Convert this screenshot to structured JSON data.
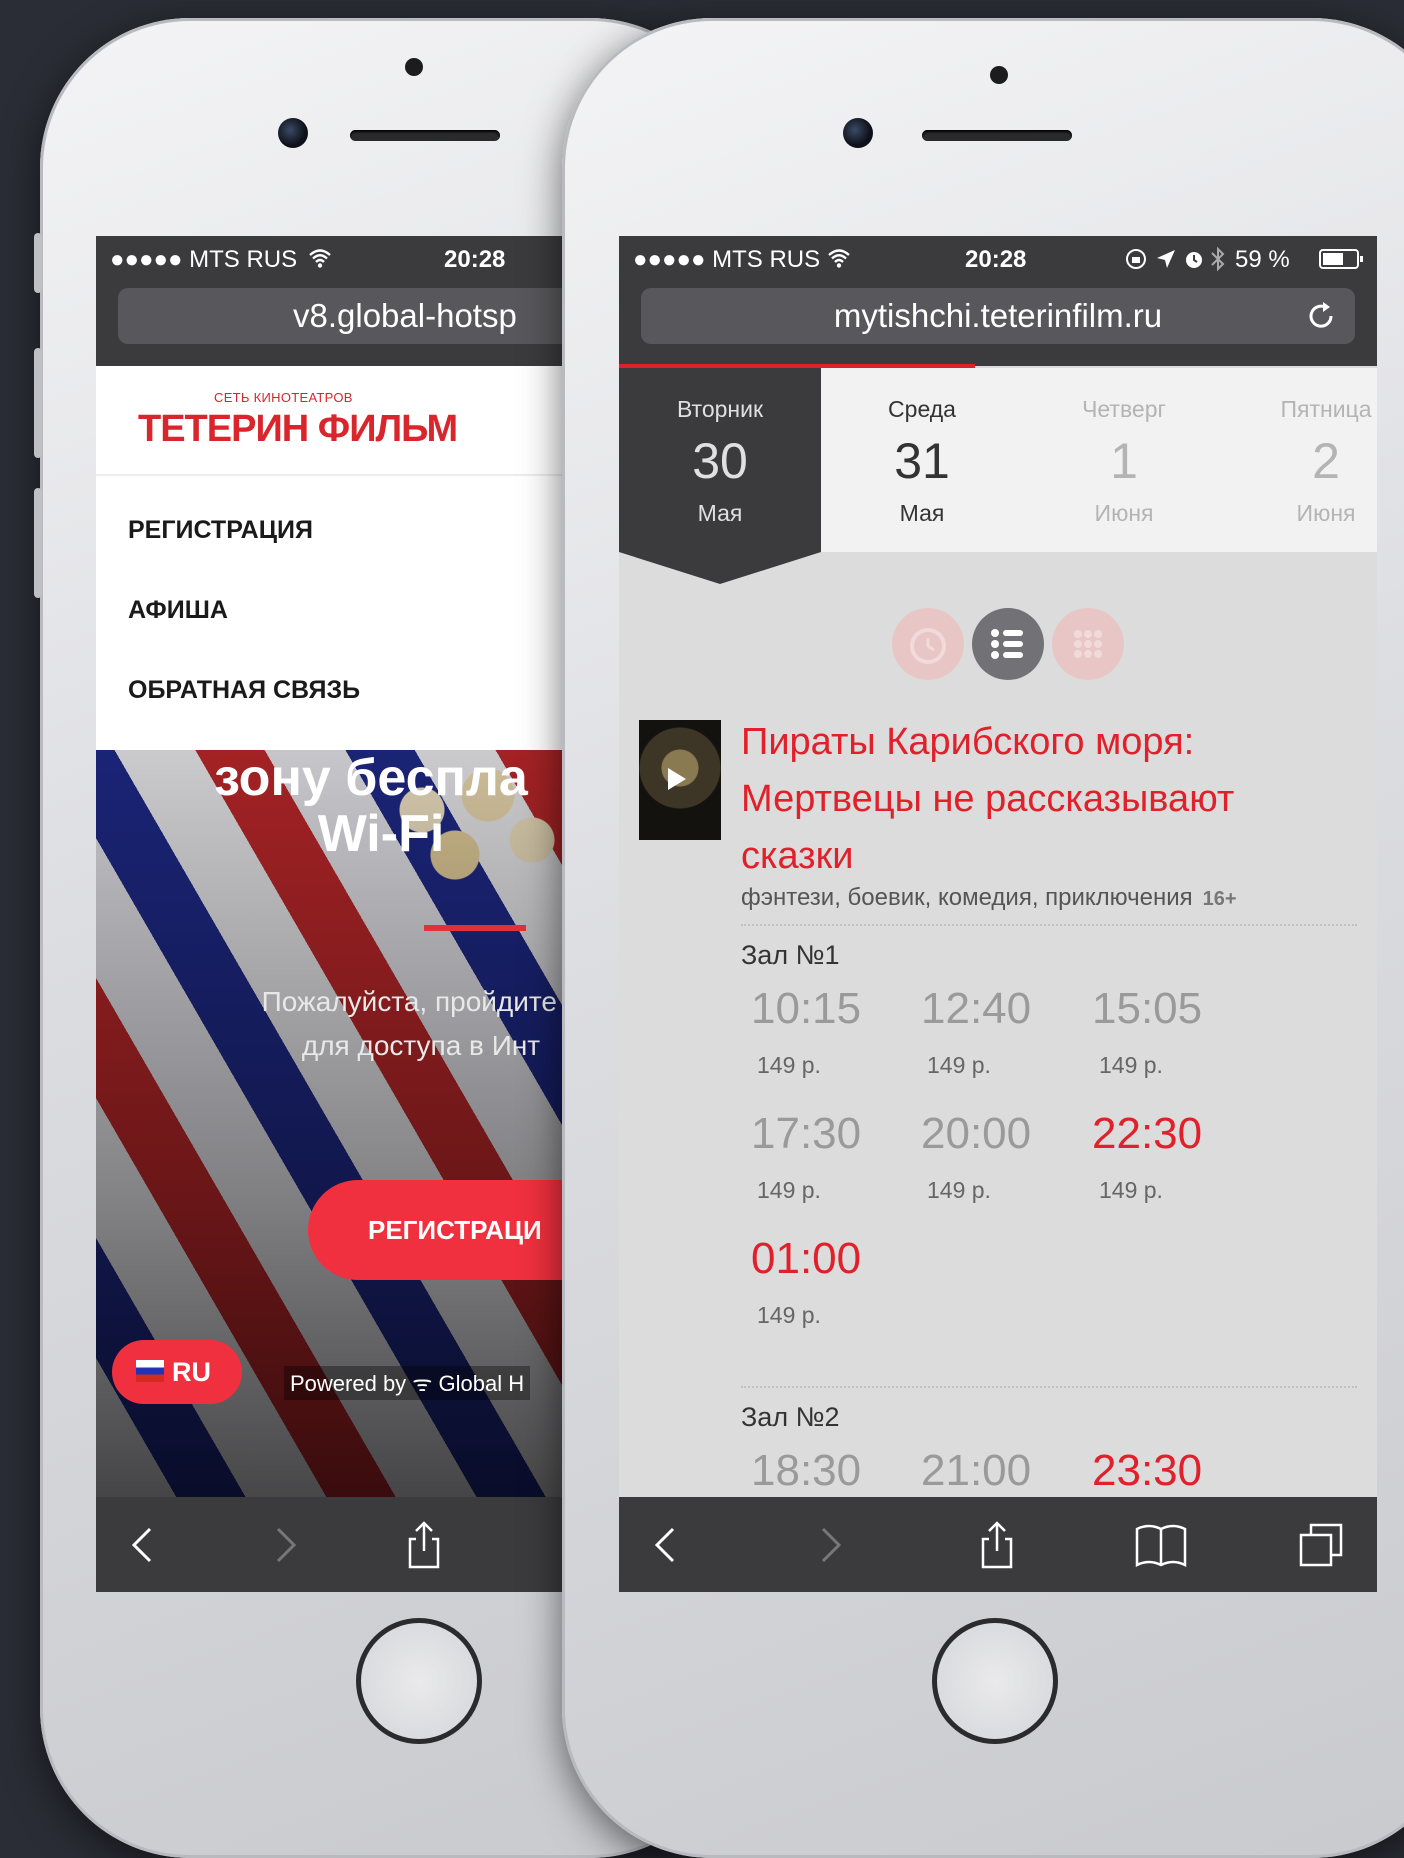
{
  "left_phone": {
    "status": {
      "carrier": "●●●●● MTS RUS ",
      "time": "20:28"
    },
    "url": "v8.global-hotsp",
    "logo": {
      "small": "СЕТЬ КИНОТЕАТРОВ",
      "big": "ТЕТЕРИН ФИЛЬМ"
    },
    "menu": [
      "РЕГИСТРАЦИЯ",
      "АФИША",
      "ОБРАТНАЯ СВЯЗЬ"
    ],
    "hero": {
      "title_line1": "зону беспла",
      "title_line2": "Wi-Fi",
      "text_line1": "Пожалуйста, пройдите р",
      "text_line2": "для доступа в Инт"
    },
    "register_button": "РЕГИСТРАЦИ",
    "language": "RU",
    "powered": "Powered by ᯤ Global H"
  },
  "right_phone": {
    "status": {
      "carrier": "●●●●● MTS RUS ",
      "time": "20:28",
      "battery": "59 %"
    },
    "url": "mytishchi.teterinfilm.ru",
    "days": [
      {
        "name": "Вторник",
        "num": "30",
        "month": "Мая",
        "state": "active"
      },
      {
        "name": "Среда",
        "num": "31",
        "month": "Мая",
        "state": "normal"
      },
      {
        "name": "Четверг",
        "num": "1",
        "month": "Июня",
        "state": "dim"
      },
      {
        "name": "Пятница",
        "num": "2",
        "month": "Июня",
        "state": "dim"
      }
    ],
    "movie": {
      "title_lines": [
        "Пираты Карибского моря:",
        "Мертвецы не рассказывают",
        "сказки"
      ],
      "genre": "фэнтези, боевик, комедия, приключения",
      "age": "16+"
    },
    "halls": [
      {
        "name": "Зал №1",
        "sessions": [
          {
            "time": "10:15",
            "price": "149 р.",
            "late": false
          },
          {
            "time": "12:40",
            "price": "149 р.",
            "late": false
          },
          {
            "time": "15:05",
            "price": "149 р.",
            "late": false
          },
          {
            "time": "17:30",
            "price": "149 р.",
            "late": false
          },
          {
            "time": "20:00",
            "price": "149 р.",
            "late": false
          },
          {
            "time": "22:30",
            "price": "149 р.",
            "late": true
          },
          {
            "time": "01:00",
            "price": "149 р.",
            "late": true
          }
        ]
      },
      {
        "name": "Зал №2",
        "sessions": [
          {
            "time": "18:30",
            "late": false
          },
          {
            "time": "21:00",
            "late": false
          },
          {
            "time": "23:30",
            "late": true
          }
        ]
      }
    ]
  },
  "colors": {
    "accent": "#e0202a",
    "toolbar": "#3b3b3e",
    "background": "#2b2d36"
  }
}
